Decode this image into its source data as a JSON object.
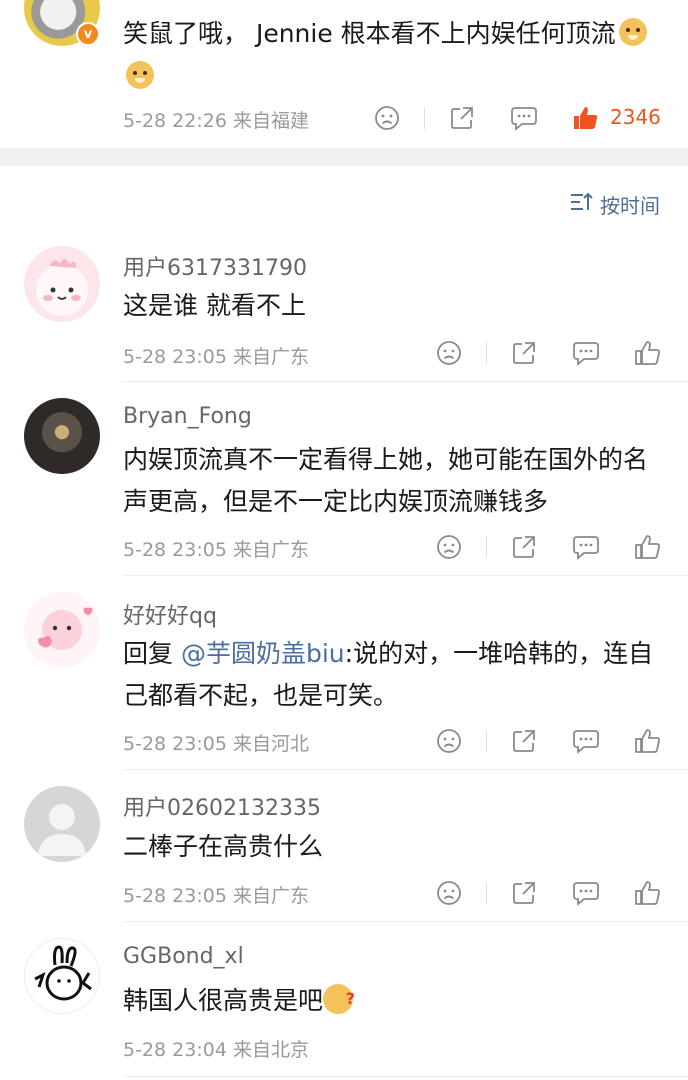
{
  "top_comment": {
    "badge": "v",
    "text": "笑鼠了哦， Jennie 根本看不上内娱任何顶流",
    "meta": "5-28 22:26  来自福建",
    "like_count": "2346",
    "accent": "#f0531f"
  },
  "sort": {
    "label": "按时间"
  },
  "comments": [
    {
      "username": "用户6317331790",
      "text": "这是谁 就看不上",
      "meta": "5-28 23:05  来自广东"
    },
    {
      "username": "Bryan_Fong",
      "text": "内娱顶流真不一定看得上她，她可能在国外的名声更高，但是不一定比内娱顶流赚钱多",
      "meta": "5-28 23:05  来自广东"
    },
    {
      "username": "好好好qq",
      "reply_prefix": "回复",
      "mention": "@芋圆奶盖biu",
      "text": ":说的对，一堆哈韩的，连自己都看不起，也是可笑。",
      "meta": "5-28 23:05  来自河北"
    },
    {
      "username": "用户02602132335",
      "text": "二棒子在高贵什么",
      "meta": "5-28 23:05  来自广东"
    },
    {
      "username": "GGBond_xl",
      "text": "韩国人很高贵是吧",
      "meta": "5-28 23:04  来自北京"
    }
  ],
  "icons": {
    "dislike": "sad-face-icon",
    "share": "share-icon",
    "comment": "comment-bubble-icon",
    "like": "thumbs-up-icon",
    "sort": "sort-icon"
  }
}
